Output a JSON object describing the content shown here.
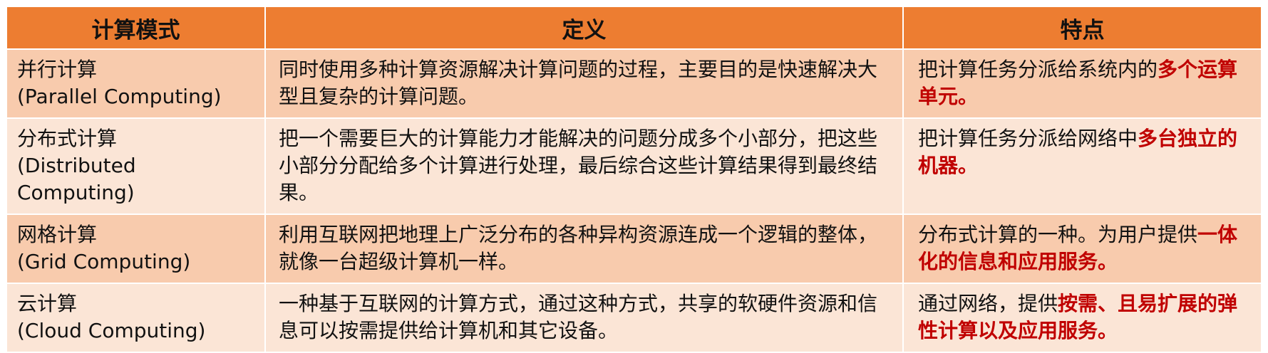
{
  "table": {
    "headers": [
      "计算模式",
      "定义",
      "特点"
    ],
    "rows": [
      {
        "mode_cn": "并行计算",
        "mode_en": "(Parallel Computing)",
        "definition": "同时使用多种计算资源解决计算问题的过程，主要目的是快速解决大型且复杂的计算问题。",
        "feature_plain": "把计算任务分派给系统内的",
        "feature_highlight": "多个运算单元。"
      },
      {
        "mode_cn": "分布式计算",
        "mode_en": "(Distributed Computing)",
        "definition": "把一个需要巨大的计算能力才能解决的问题分成多个小部分，把这些小部分分配给多个计算进行处理，最后综合这些计算结果得到最终结果。",
        "feature_plain": "把计算任务分派给网络中",
        "feature_highlight": "多台独立的机器。"
      },
      {
        "mode_cn": "网格计算",
        "mode_en": "(Grid Computing)",
        "definition": "利用互联网把地理上广泛分布的各种异构资源连成一个逻辑的整体，就像一台超级计算机一样。",
        "feature_plain": "分布式计算的一种。为用户提供",
        "feature_highlight": "一体化的信息和应用服务。"
      },
      {
        "mode_cn": "云计算",
        "mode_en": "(Cloud Computing)",
        "definition": "一种基于互联网的计算方式，通过这种方式，共享的软硬件资源和信息可以按需提供给计算机和其它设备。",
        "feature_plain": "通过网络，提供",
        "feature_highlight": "按需、且易扩展的弹性计算以及应用服务。"
      }
    ]
  },
  "colors": {
    "header_bg": "#ed7d31",
    "row_odd_bg": "#f8cbad",
    "row_even_bg": "#fbe5d6",
    "highlight_text": "#c00000"
  }
}
